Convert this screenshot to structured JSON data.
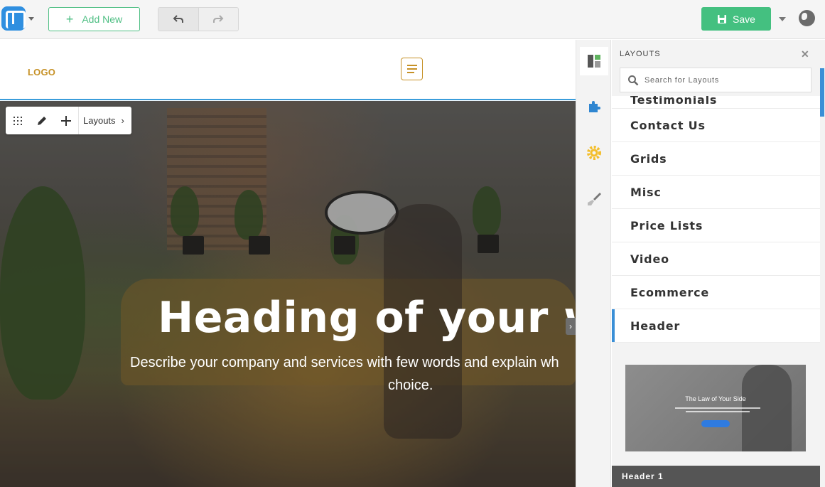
{
  "toolbar": {
    "add_new_label": "Add New",
    "save_label": "Save"
  },
  "site": {
    "logo_text": "LOGO",
    "hero_heading": "Heading of your web",
    "hero_description_line1": "Describe your company and services with few words and explain wh",
    "hero_description_line2": "choice."
  },
  "block_toolbar": {
    "layouts_label": "Layouts"
  },
  "panel": {
    "title": "LAYOUTS",
    "search_placeholder": "Search for Layouts",
    "categories": [
      {
        "label": "Testimonials"
      },
      {
        "label": "Contact Us"
      },
      {
        "label": "Grids"
      },
      {
        "label": "Misc"
      },
      {
        "label": "Price Lists"
      },
      {
        "label": "Video"
      },
      {
        "label": "Ecommerce"
      },
      {
        "label": "Header",
        "active": true
      }
    ],
    "thumbnail": {
      "title": "The Law of Your Side",
      "caption": "Header 1"
    }
  },
  "colors": {
    "accent_green": "#44c080",
    "accent_blue": "#3a8fd6",
    "logo_gold": "#c69126"
  },
  "icons": [
    "app-logo-icon",
    "plus-icon",
    "undo-icon",
    "redo-icon",
    "save-icon",
    "globe-icon",
    "grid-drag-icon",
    "pencil-icon",
    "layouts-panel-icon",
    "puzzle-icon",
    "gear-icon",
    "brush-icon",
    "search-icon",
    "close-icon"
  ]
}
